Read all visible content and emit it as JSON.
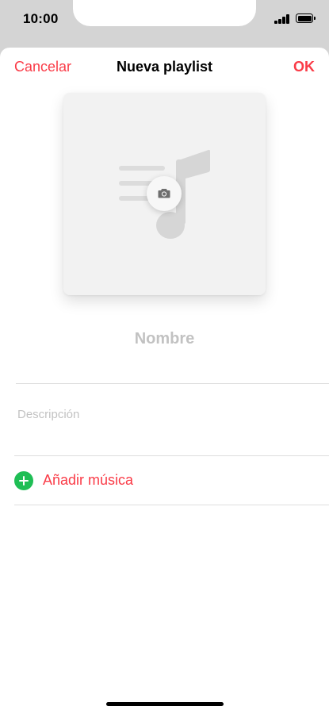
{
  "status_bar": {
    "time": "10:00"
  },
  "nav": {
    "cancel_label": "Cancelar",
    "title": "Nueva playlist",
    "ok_label": "OK"
  },
  "artwork": {
    "placeholder_icon": "music-note-list-icon",
    "camera_icon": "camera-icon"
  },
  "form": {
    "name_placeholder": "Nombre",
    "description_placeholder": "Descripción"
  },
  "actions": {
    "add_music_label": "Añadir música",
    "add_music_icon": "plus-circle-icon"
  },
  "colors": {
    "accent": "#fa3b47",
    "add_icon": "#1fbe55",
    "placeholder_text": "#c2c2c2"
  }
}
